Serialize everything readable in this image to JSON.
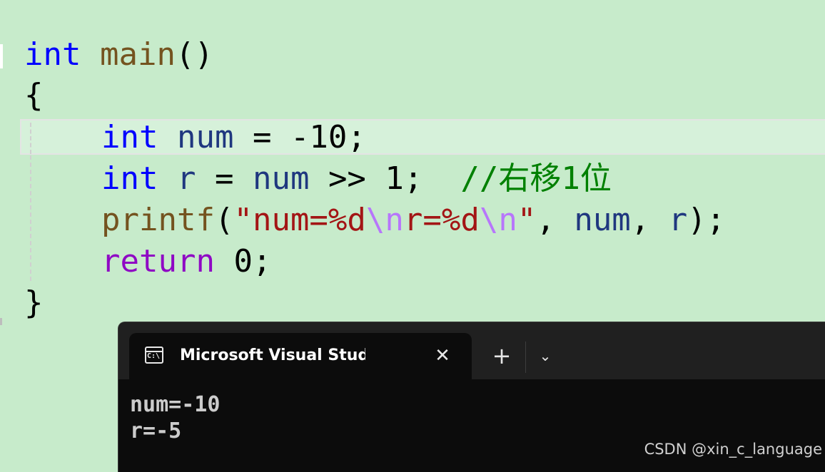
{
  "editor": {
    "line1": {
      "kw": "int",
      "fn": "main",
      "rest": "()"
    },
    "line2": "{",
    "line3": {
      "kw": "int",
      "var": "num",
      "rest": " = -10;"
    },
    "line4": {
      "kw": "int",
      "var1": "r",
      "mid": " = ",
      "var2": "num",
      "rest": " >> 1;  ",
      "comment": "//右移1位"
    },
    "line5": {
      "fn": "printf",
      "open": "(",
      "q1": "\"",
      "s1": "num=%d",
      "e1": "\\n",
      "s2": "r=%d",
      "e2": "\\n",
      "q2": "\"",
      "c1": ", ",
      "v1": "num",
      "c2": ", ",
      "v2": "r",
      "close": ");"
    },
    "line6": {
      "kw": "return",
      "rest": " 0;"
    },
    "line7": "}"
  },
  "terminal": {
    "tab_title": "Microsoft Visual Studio 调试控制台",
    "icon_text": "C:\\",
    "close_glyph": "✕",
    "new_tab_glyph": "+",
    "dropdown_glyph": "⌄",
    "output": [
      "num=-10",
      "r=-5"
    ]
  },
  "watermark": "CSDN @xin_c_language"
}
